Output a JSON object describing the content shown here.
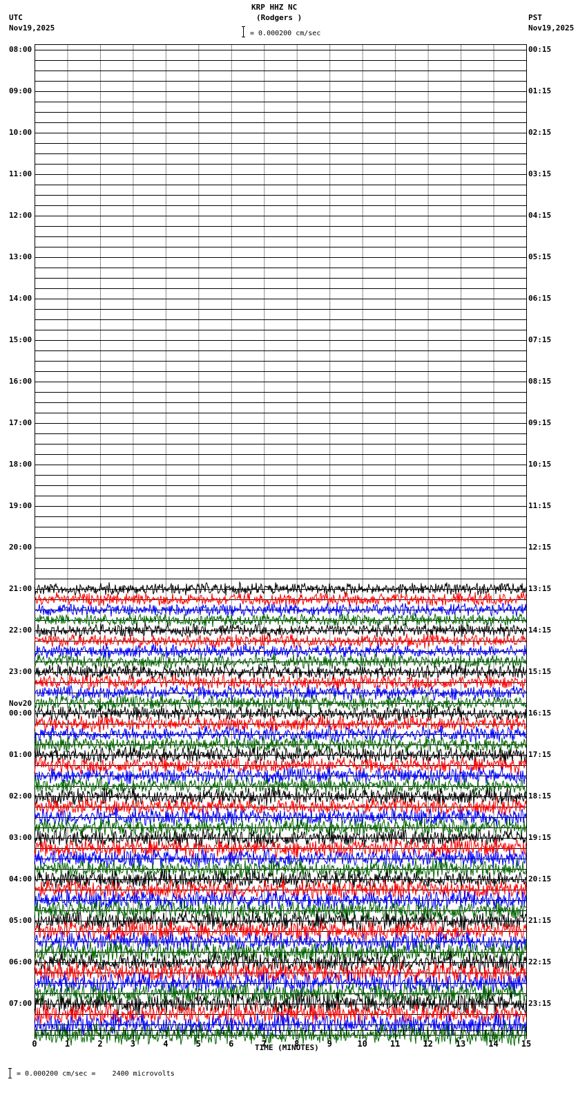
{
  "header": {
    "station": "KRP HHZ NC",
    "location": "(Rodgers )",
    "left_zone": "UTC",
    "left_date": "Nov19,2025",
    "right_zone": "PST",
    "right_date": "Nov19,2025",
    "scale": "= 0.000200 cm/sec"
  },
  "footer": {
    "scale": "= 0.000200 cm/sec =    2400 microvolts"
  },
  "chart_data": {
    "type": "line",
    "title": "KRP HHZ NC (Rodgers )",
    "xlabel": "TIME (MINUTES)",
    "xlim": [
      0,
      15
    ],
    "x_ticks": [
      "0",
      "1",
      "2",
      "3",
      "4",
      "5",
      "6",
      "7",
      "8",
      "9",
      "10",
      "11",
      "12",
      "13",
      "14",
      "15"
    ],
    "traces_per_hour": 4,
    "total_rows": 96,
    "first_active_row": 52,
    "left_labels": [
      "08:00",
      "09:00",
      "10:00",
      "11:00",
      "12:00",
      "13:00",
      "14:00",
      "15:00",
      "16:00",
      "17:00",
      "18:00",
      "19:00",
      "20:00",
      "21:00",
      "22:00",
      "23:00",
      "00:00",
      "01:00",
      "02:00",
      "03:00",
      "04:00",
      "05:00",
      "06:00",
      "07:00"
    ],
    "left_date_change": {
      "hour_index": 16,
      "label": "Nov20"
    },
    "right_labels": [
      "00:15",
      "01:15",
      "02:15",
      "03:15",
      "04:15",
      "05:15",
      "06:15",
      "07:15",
      "08:15",
      "09:15",
      "10:15",
      "11:15",
      "12:15",
      "13:15",
      "14:15",
      "15:15",
      "16:15",
      "17:15",
      "18:15",
      "19:15",
      "20:15",
      "21:15",
      "22:15",
      "23:15"
    ],
    "trace_colors": [
      "#000000",
      "#ff0000",
      "#0000ff",
      "#006600"
    ],
    "grid": true
  }
}
